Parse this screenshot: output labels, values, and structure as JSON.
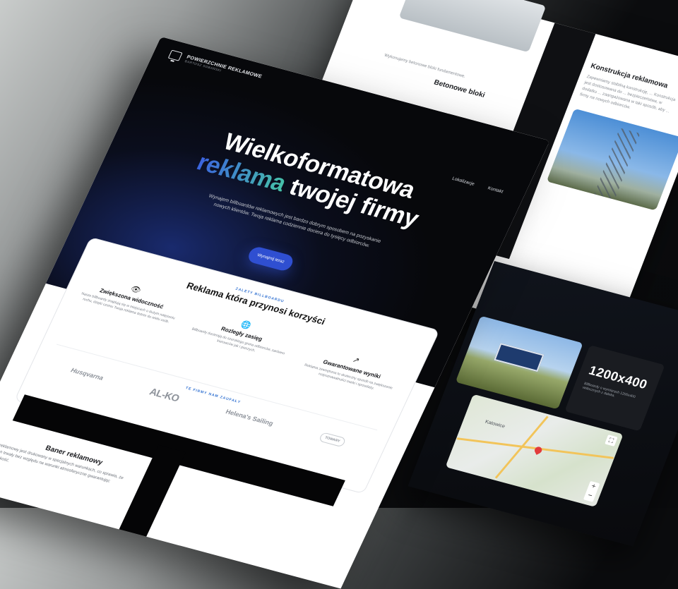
{
  "back_page": {
    "beton_title": "Betonowe bloki",
    "beton_text": "Wykonujemy betonowe bloki fundamentowe.",
    "konstr_title": "Konstrukcja reklamowa",
    "konstr_text": "Zapewniamy stabilną konstrukcję, ... Konstrukcja jest dostosowana do ... bezpieczeństwa, w dodatku ... zaangażowana w taki sposób, aby ... firmy na nowych odbiorców."
  },
  "dark_page": {
    "size": "1200x400",
    "size_desc": "Billboardy o wymiarach 1200x400 widocznych z daleka.",
    "map_city": "Katowice",
    "zoom_plus": "+",
    "zoom_minus": "−",
    "fullscreen": "⛶"
  },
  "main_page": {
    "logo_title": "POWIERZCHNIE REKLAMOWE",
    "logo_sub": "BARTOSZ SOBAŃSKI",
    "nav": [
      "Lokalizacje",
      "Kontakt"
    ],
    "headline_line1": "Wielkoformatowa",
    "headline_accent": "reklama",
    "headline_rest": " twojej firmy",
    "hero_desc": "Wynajem billboardów reklamowych jest bardzo dobrym sposobem na pozyskanie nowych klientów. Twoja reklama codziennie dociera do tysięcy odbiorców.",
    "cta": "Wynajmij teraz",
    "benefits_eyebrow": "ZALETY BILLBOARDU",
    "benefits_title": "Reklama która przynosi korzyści",
    "features": [
      {
        "icon": "👁",
        "title": "Zwiększona widoczność",
        "desc": "Nasze billboardy znajdują się w miejscach o dużym natężeniu ruchu, dzięki czemu Twoja reklama dotrze do wielu osób."
      },
      {
        "icon": "🌐",
        "title": "Rozległy zasięg",
        "desc": "Billboardy docierają do szerokiego grona odbiorców, zarówno kierowców jak i pieszych."
      },
      {
        "icon": "↗",
        "title": "Gwarantowane wyniki",
        "desc": "Reklama zewnętrzna to skuteczny sposób na zwiększenie rozpoznawalności marki i sprzedaży."
      }
    ],
    "trust_eyebrow": "TE FIRMY NAM ZAUFAŁY",
    "logos": [
      "Husqvarna",
      "AL-KO",
      "Helena's Sailing",
      "TOWARY"
    ],
    "banner_title": "Baner reklamowy",
    "banner_text": "Baner reklamowy jest drukowany w specjalnych warunkach, co sprawia, że będzie on trwały bez względu na warunki atmosferyczne gwarantując wysoką jakość."
  }
}
